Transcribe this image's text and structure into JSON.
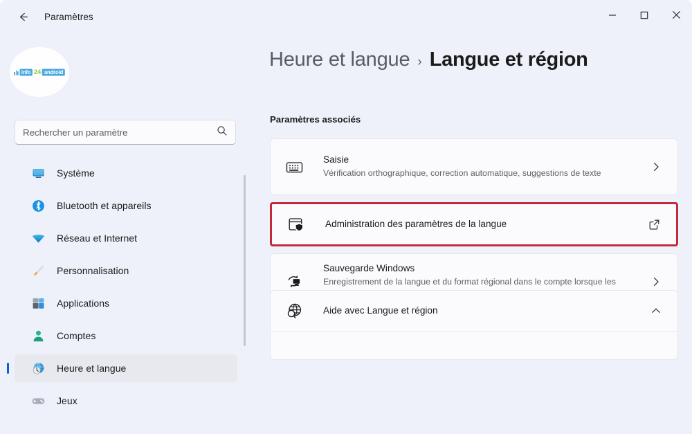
{
  "window": {
    "title": "Paramètres",
    "back_label": "Précédent",
    "controls": {
      "minimize": "Réduire",
      "maximize": "Agrandir",
      "close": "Fermer"
    }
  },
  "watermark": {
    "prefix": "info",
    "mid": "24",
    "suffix": "android"
  },
  "search": {
    "placeholder": "Rechercher un paramètre",
    "value": ""
  },
  "sidebar": {
    "items": [
      {
        "label": "Système",
        "icon": "monitor-icon",
        "selected": false
      },
      {
        "label": "Bluetooth et appareils",
        "icon": "bluetooth-icon",
        "selected": false
      },
      {
        "label": "Réseau et Internet",
        "icon": "wifi-icon",
        "selected": false
      },
      {
        "label": "Personnalisation",
        "icon": "paintbrush-icon",
        "selected": false
      },
      {
        "label": "Applications",
        "icon": "apps-icon",
        "selected": false
      },
      {
        "label": "Comptes",
        "icon": "person-icon",
        "selected": false
      },
      {
        "label": "Heure et langue",
        "icon": "clock-globe-icon",
        "selected": true
      },
      {
        "label": "Jeux",
        "icon": "gamepad-icon",
        "selected": false
      }
    ]
  },
  "main": {
    "breadcrumb": {
      "parent": "Heure et langue",
      "separator": "›",
      "current": "Langue et région"
    },
    "section_label": "Paramètres associés",
    "cards": [
      {
        "title": "Saisie",
        "description": "Vérification orthographique, correction automatique, suggestions de texte",
        "icon": "keyboard-icon",
        "action": "chevron-right-icon",
        "highlighted": false
      },
      {
        "title": "Administration des paramètres de la langue",
        "description": "",
        "icon": "admin-language-shield-icon",
        "action": "external-link-icon",
        "highlighted": true
      },
      {
        "title": "Sauvegarde Windows",
        "description": "Enregistrement de la langue et du format régional dans le compte lorsque les préférences linguistiques sont vérifiées.",
        "icon": "backup-sync-icon",
        "action": "chevron-right-icon",
        "highlighted": false
      }
    ],
    "help": {
      "title": "Aide avec Langue et région",
      "icon": "globe-search-icon",
      "action": "chevron-up-icon",
      "expanded": true
    }
  },
  "colors": {
    "background": "#eef1f9",
    "card": "#fbfbfd",
    "highlight_border": "#c42b3a",
    "accent": "#0f5fcf",
    "selected_nav": "#e7e9ef"
  }
}
